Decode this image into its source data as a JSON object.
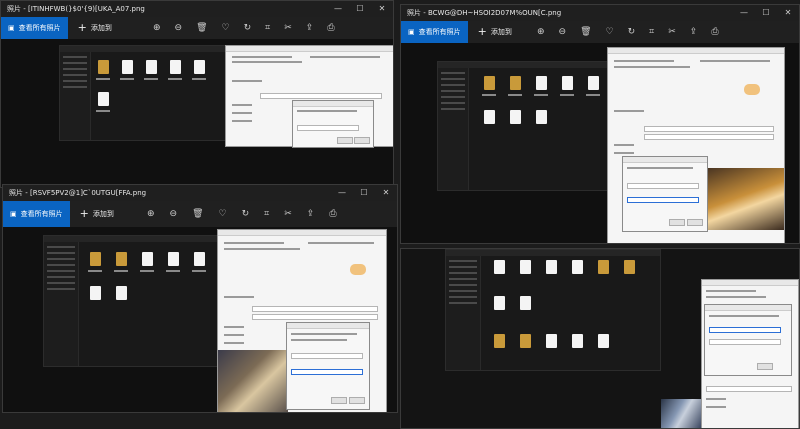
{
  "app_name": "照片",
  "windows": [
    {
      "id": "w1",
      "title": "照片 - [ITINHFWB(}$0'{9)[UKA_A07.png",
      "view_all_label": "查看所有照片",
      "add_label": "添加到",
      "toolbar_icons": [
        "zoom-in-icon",
        "zoom-out-icon",
        "delete-icon",
        "favorite-icon",
        "rotate-icon",
        "crop-icon",
        "edit-icon",
        "share-icon",
        "print-icon"
      ]
    },
    {
      "id": "w2",
      "title": "照片 - BCWG@DH~HSOI2D07M%OUN[C.png",
      "view_all_label": "查看所有照片",
      "add_label": "添加到",
      "toolbar_icons": [
        "zoom-in-icon",
        "zoom-out-icon",
        "delete-icon",
        "favorite-icon",
        "rotate-icon",
        "crop-icon",
        "edit-icon",
        "share-icon",
        "print-icon"
      ]
    },
    {
      "id": "w3",
      "title": "照片 - [RSVF5PV2@1]C`0UTGU[FFA.png",
      "view_all_label": "查看所有照片",
      "add_label": "添加到",
      "toolbar_icons": [
        "zoom-in-icon",
        "zoom-out-icon",
        "delete-icon",
        "favorite-icon",
        "rotate-icon",
        "crop-icon",
        "edit-icon",
        "share-icon",
        "print-icon"
      ]
    }
  ],
  "controls": {
    "minimize": "—",
    "maximize": "☐",
    "close": "✕"
  },
  "icon_glyphs": {
    "zoom-in-icon": "⊕",
    "zoom-out-icon": "⊖",
    "delete-icon": "🗑",
    "favorite-icon": "♡",
    "rotate-icon": "↻",
    "crop-icon": "⌗",
    "edit-icon": "✂",
    "share-icon": "⇪",
    "print-icon": "⎙"
  },
  "colors": {
    "accent": "#0a64c2",
    "titlebar": "#1f1f1f",
    "toolbar": "#202020"
  }
}
